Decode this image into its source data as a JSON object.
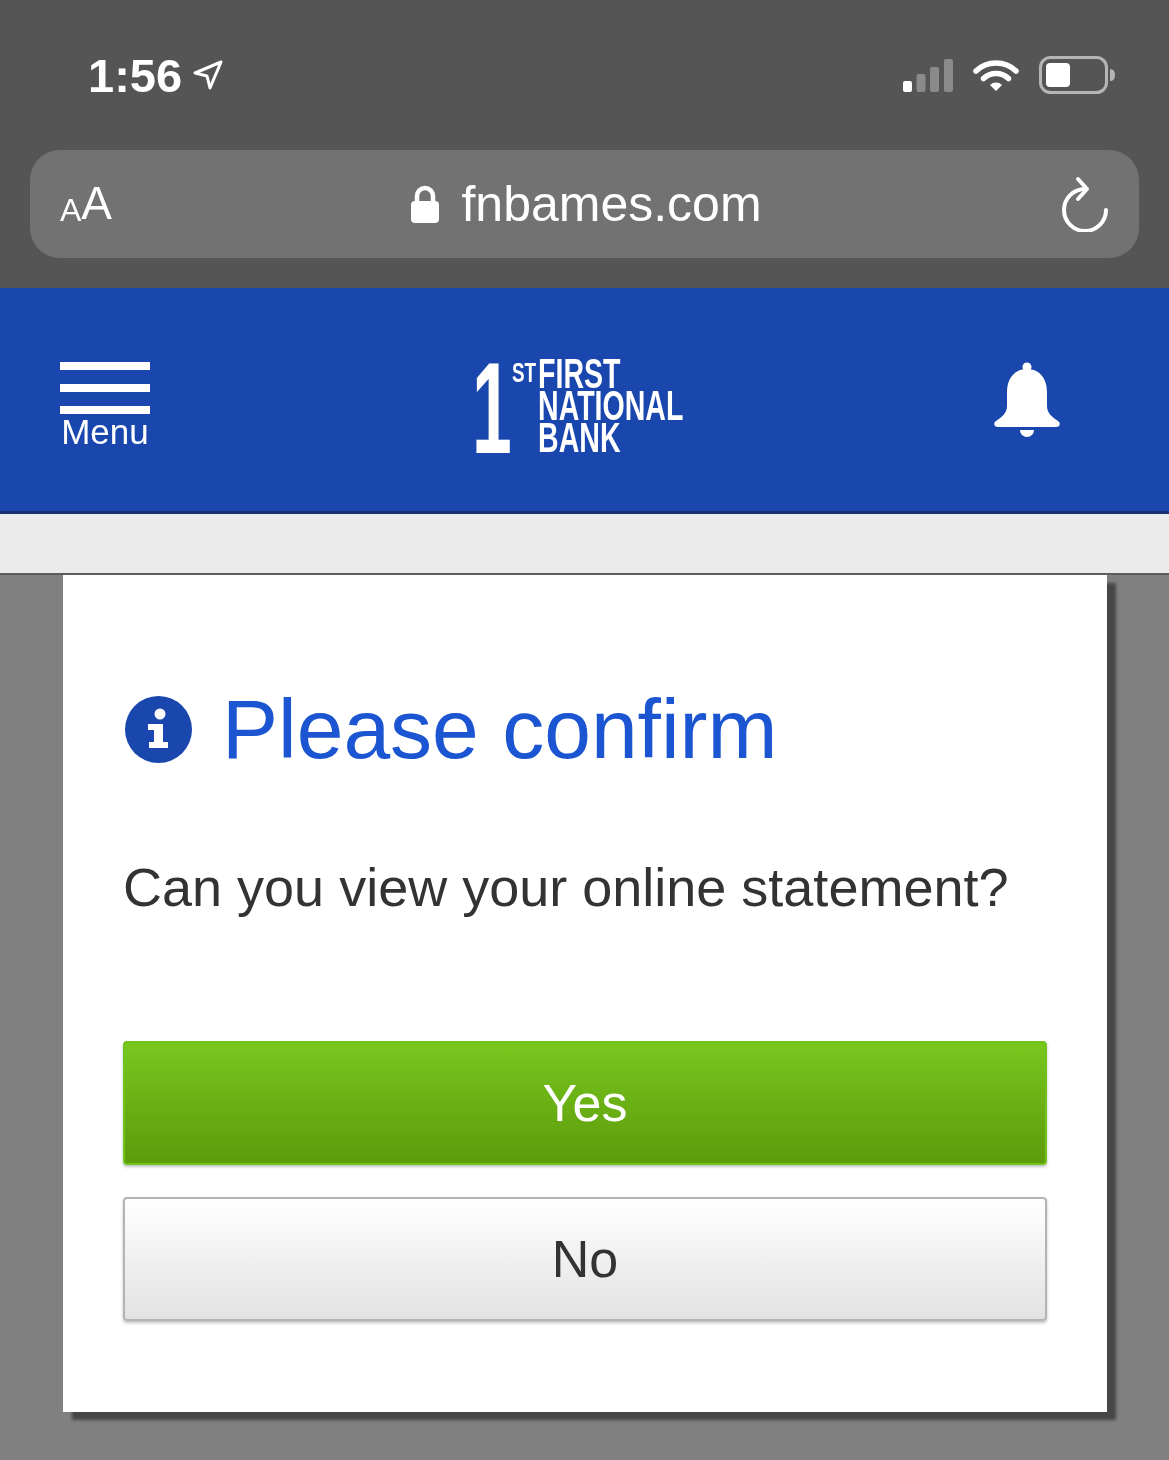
{
  "status_bar": {
    "time": "1:56"
  },
  "address_bar": {
    "text_size_button": {
      "small": "A",
      "large": "A"
    },
    "url": "fnbames.com"
  },
  "header": {
    "menu_label": "Menu",
    "logo": {
      "numeral": "1",
      "suffix": "ST",
      "lines": [
        "FIRST",
        "NATIONAL",
        "BANK"
      ]
    }
  },
  "dialog": {
    "title": "Please confirm",
    "message": "Can you view your online statement?",
    "buttons": [
      {
        "label": "Yes",
        "kind": "primary"
      },
      {
        "label": "No",
        "kind": "secondary"
      }
    ]
  }
}
